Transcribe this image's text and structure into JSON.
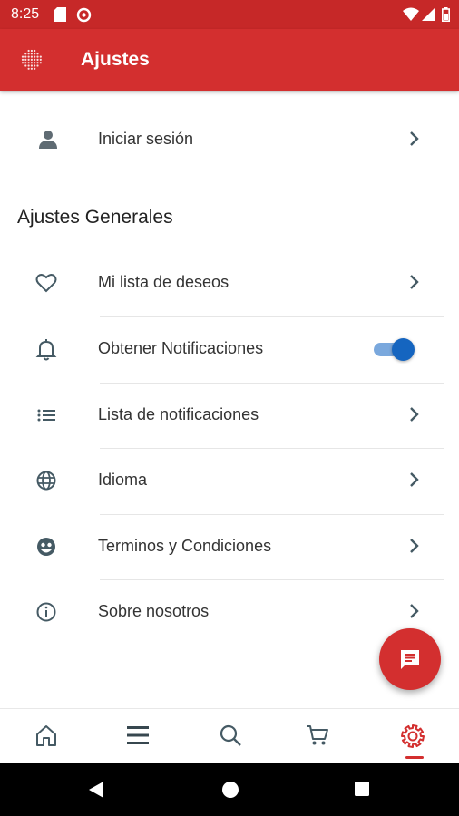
{
  "status_bar": {
    "time": "8:25",
    "icons": [
      "sd-card-icon",
      "data-saver-icon",
      "wifi-icon",
      "signal-icon",
      "battery-icon"
    ]
  },
  "app_bar": {
    "title": "Ajustes",
    "logo_icon": "grid-dots-logo-icon"
  },
  "account": {
    "label": "Iniciar sesión",
    "icon": "person-icon"
  },
  "general": {
    "title": "Ajustes Generales",
    "items": [
      {
        "label": "Mi lista de deseos",
        "icon": "heart-icon",
        "type": "link"
      },
      {
        "label": "Obtener Notificaciones",
        "icon": "bell-icon",
        "type": "toggle",
        "toggle_on": true
      },
      {
        "label": "Lista de notificaciones",
        "icon": "list-icon",
        "type": "link"
      },
      {
        "label": "Idioma",
        "icon": "globe-icon",
        "type": "link"
      },
      {
        "label": "Terminos y Condiciones",
        "icon": "terms-icon",
        "type": "link"
      },
      {
        "label": "Sobre nosotros",
        "icon": "info-icon",
        "type": "link"
      }
    ]
  },
  "fab": {
    "icon": "chat-message-icon"
  },
  "bottom_nav": {
    "items": [
      {
        "name": "home",
        "icon": "home-icon",
        "active": false
      },
      {
        "name": "menu",
        "icon": "menu-icon",
        "active": false
      },
      {
        "name": "search",
        "icon": "search-icon",
        "active": false
      },
      {
        "name": "cart",
        "icon": "cart-icon",
        "active": false
      },
      {
        "name": "settings",
        "icon": "gear-icon",
        "active": true
      }
    ]
  },
  "colors": {
    "primary": "#d32f2f",
    "status_bar": "#c62828",
    "toggle_thumb": "#1565c0",
    "toggle_track": "#7aa8dd",
    "icon_gray": "#455a64",
    "nav_gray": "#37474f"
  }
}
